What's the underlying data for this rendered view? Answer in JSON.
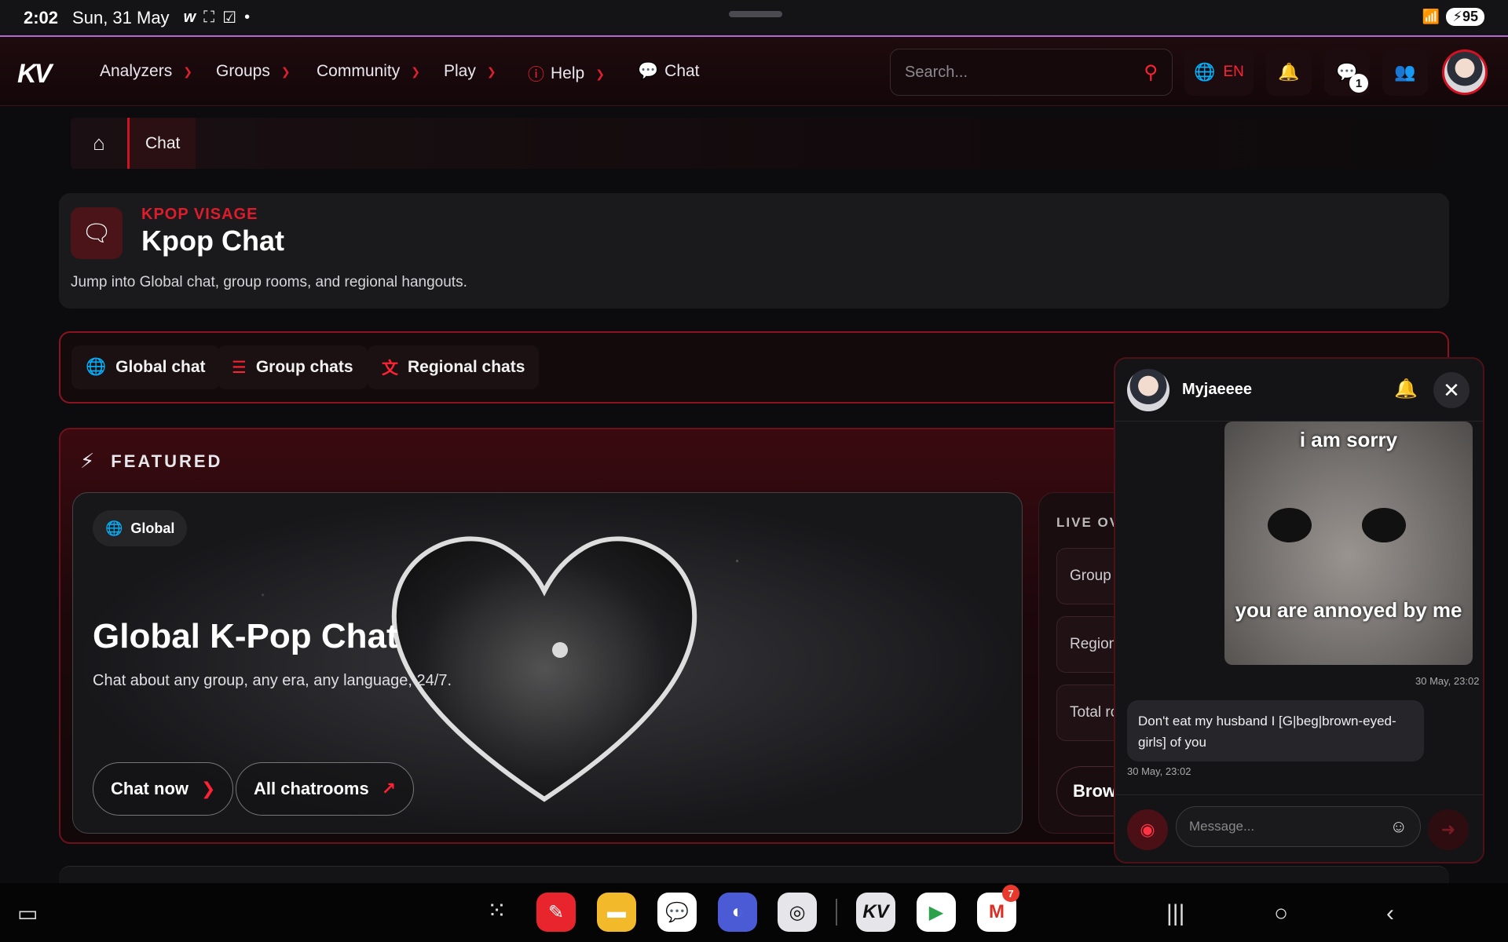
{
  "status_bar": {
    "time": "2:02",
    "date": "Sun, 31 May",
    "battery": "95"
  },
  "nav": {
    "logo": "KV",
    "items": [
      "Analyzers",
      "Groups",
      "Community",
      "Play",
      "Help",
      "Chat"
    ],
    "search_placeholder": "Search...",
    "language": "EN",
    "chat_badge": "1"
  },
  "breadcrumb": {
    "current": "Chat"
  },
  "header": {
    "kicker": "KPOP VISAGE",
    "title": "Kpop Chat",
    "description": "Jump into Global chat, group rooms, and regional hangouts."
  },
  "tabs": [
    "Global chat",
    "Group chats",
    "Regional chats"
  ],
  "featured": {
    "section_title": "FEATURED",
    "hero": {
      "chip": "Global",
      "title": "Global K-Pop Chat",
      "subtitle": "Chat about any group, any era, any language, 24/7.",
      "btn_chat": "Chat now",
      "btn_all": "All chatrooms"
    },
    "side": {
      "heading": "LIVE OVER",
      "rows": [
        "Group r",
        "Regiona",
        "Total ro"
      ],
      "button": "Brows"
    }
  },
  "chat_popup": {
    "username": "Myjaeeee",
    "meme_top": "i am sorry",
    "meme_bottom": "you are annoyed by me",
    "meme_timestamp": "30 May, 23:02",
    "message": "Don't eat my husband I [G|beg|brown-eyed-girls] of you",
    "message_timestamp": "30 May, 23:02",
    "input_placeholder": "Message..."
  },
  "dock": {
    "gmail_badge": "7"
  },
  "colors": {
    "accent": "#e01c2c",
    "background": "#0c0c0e"
  }
}
